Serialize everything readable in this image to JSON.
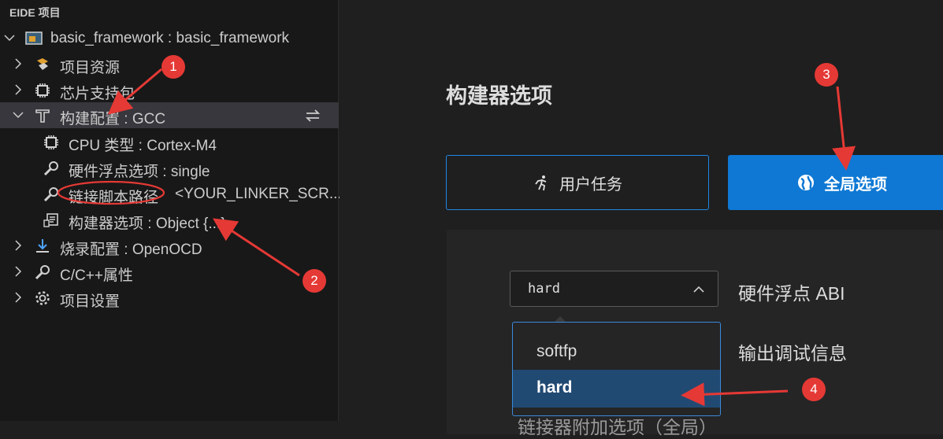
{
  "sidebar": {
    "header": "EIDE 项目",
    "project": "basic_framework : basic_framework",
    "items": [
      {
        "label": "项目资源",
        "icon": "resource-icon"
      },
      {
        "label": "芯片支持包",
        "icon": "chip-icon"
      },
      {
        "label": "构建配置 : GCC",
        "icon": "build-tool-icon"
      },
      {
        "label": "CPU 类型 : Cortex-M4",
        "icon": "cpu-icon"
      },
      {
        "label": "硬件浮点选项 : single",
        "icon": "wrench-icon"
      },
      {
        "label": "链接脚本路径",
        "icon": "wrench-icon"
      },
      {
        "label": "<YOUR_LINKER_SCR...",
        "icon": ""
      },
      {
        "label": "构建器选项 : Object {...}",
        "icon": "builder-options-icon"
      },
      {
        "label": "烧录配置 : OpenOCD",
        "icon": "download-icon"
      },
      {
        "label": "C/C++属性",
        "icon": "wrench-icon"
      },
      {
        "label": "项目设置",
        "icon": "gear-icon"
      }
    ]
  },
  "main": {
    "title": "构建器选项",
    "tabs": {
      "user": "用户任务",
      "global": "全局选项"
    },
    "abi": {
      "value": "hard",
      "label": "硬件浮点 ABI",
      "options": [
        "softfp",
        "hard"
      ]
    },
    "debug_label": "输出调试信息",
    "linker_label": "链接器附加选项（全局）"
  },
  "annotations": {
    "badges": [
      "1",
      "2",
      "3",
      "4"
    ],
    "color": "#e53935"
  }
}
